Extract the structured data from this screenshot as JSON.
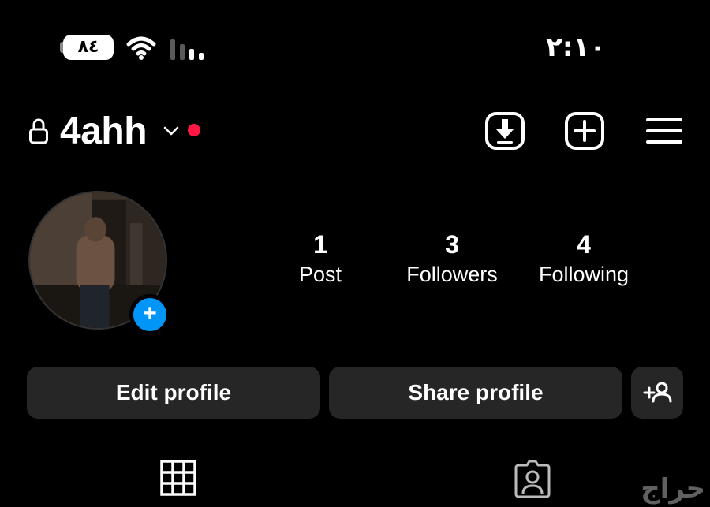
{
  "status_bar": {
    "battery": "٨٤",
    "time": "٢:١٠",
    "icons": [
      "battery-icon",
      "wifi-icon",
      "cellular-signal-icon"
    ]
  },
  "header": {
    "username": "4ahh",
    "icons": [
      "lock-icon",
      "chevron-down-icon",
      "notification-dot",
      "archive-download-icon",
      "create-plus-icon",
      "menu-icon"
    ],
    "notification_dot_color": "#ff1744"
  },
  "profile": {
    "stats": [
      {
        "count": "1",
        "label": "Post"
      },
      {
        "count": "3",
        "label": "Followers"
      },
      {
        "count": "4",
        "label": "Following"
      }
    ],
    "add_story_icon": "plus-icon",
    "add_story_color": "#0095f6"
  },
  "actions": {
    "edit_profile": "Edit profile",
    "share_profile": "Share profile",
    "discover_people_icon": "add-person-icon"
  },
  "tabs": {
    "icons": [
      "grid-icon",
      "tagged-person-icon"
    ]
  },
  "watermark": {
    "text": "حراج"
  },
  "colors": {
    "background": "#000000",
    "button_bg": "#262626",
    "accent": "#0095f6"
  }
}
